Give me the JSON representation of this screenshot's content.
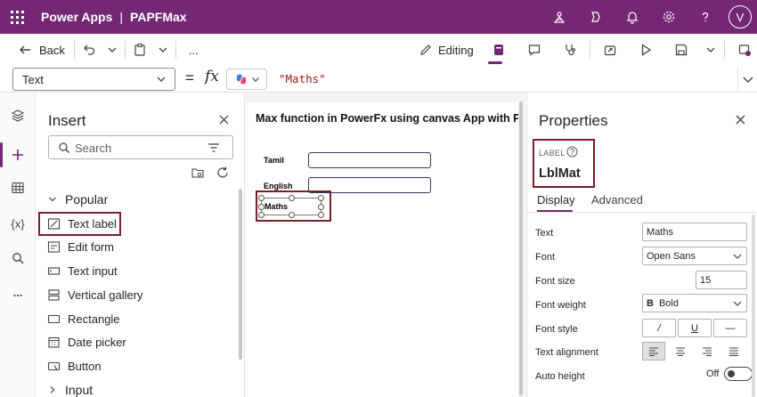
{
  "topbar": {
    "product": "Power Apps",
    "separator": "|",
    "app_file": "PAPFMax",
    "avatar_initial": "V",
    "icons": [
      "environment-icon",
      "copilot-icon",
      "notification-bell-icon",
      "settings-gear-icon",
      "help-icon"
    ],
    "bg_color": "#742774"
  },
  "command_bar": {
    "back_label": "Back",
    "more_label": "...",
    "editing_label": "Editing"
  },
  "formula_bar": {
    "property": "Text",
    "equals": "=",
    "fx": "fx",
    "formula": "\"Maths\""
  },
  "rail": {
    "variables_label": "{x}",
    "more_label": "..."
  },
  "insert_panel": {
    "title": "Insert",
    "search_placeholder": "Search",
    "popular_section": "Popular",
    "items": [
      "Text label",
      "Edit form",
      "Text input",
      "Vertical gallery",
      "Rectangle",
      "Date picker",
      "Button"
    ],
    "input_section": "Input"
  },
  "canvas": {
    "title": "Max function in  PowerFx using canvas App with Po",
    "label_tamil": "Tamil",
    "label_english": "English",
    "label_maths": "Maths"
  },
  "properties_panel": {
    "title": "Properties",
    "control_kind": "LABEL",
    "control_name": "LblMat",
    "tab_display": "Display",
    "tab_advanced": "Advanced",
    "rows": {
      "text_label": "Text",
      "text_value": "Maths",
      "font_label": "Font",
      "font_value": "Open Sans",
      "font_size_label": "Font size",
      "font_size_value": "15",
      "font_weight_label": "Font weight",
      "font_weight_value": "Bold",
      "font_weight_glyph": "B",
      "font_style_label": "Font style",
      "font_style_italic": "/",
      "font_style_underline": "U",
      "font_style_strike": "—",
      "text_alignment_label": "Text alignment",
      "auto_height_label": "Auto height",
      "auto_height_value": "Off"
    }
  }
}
